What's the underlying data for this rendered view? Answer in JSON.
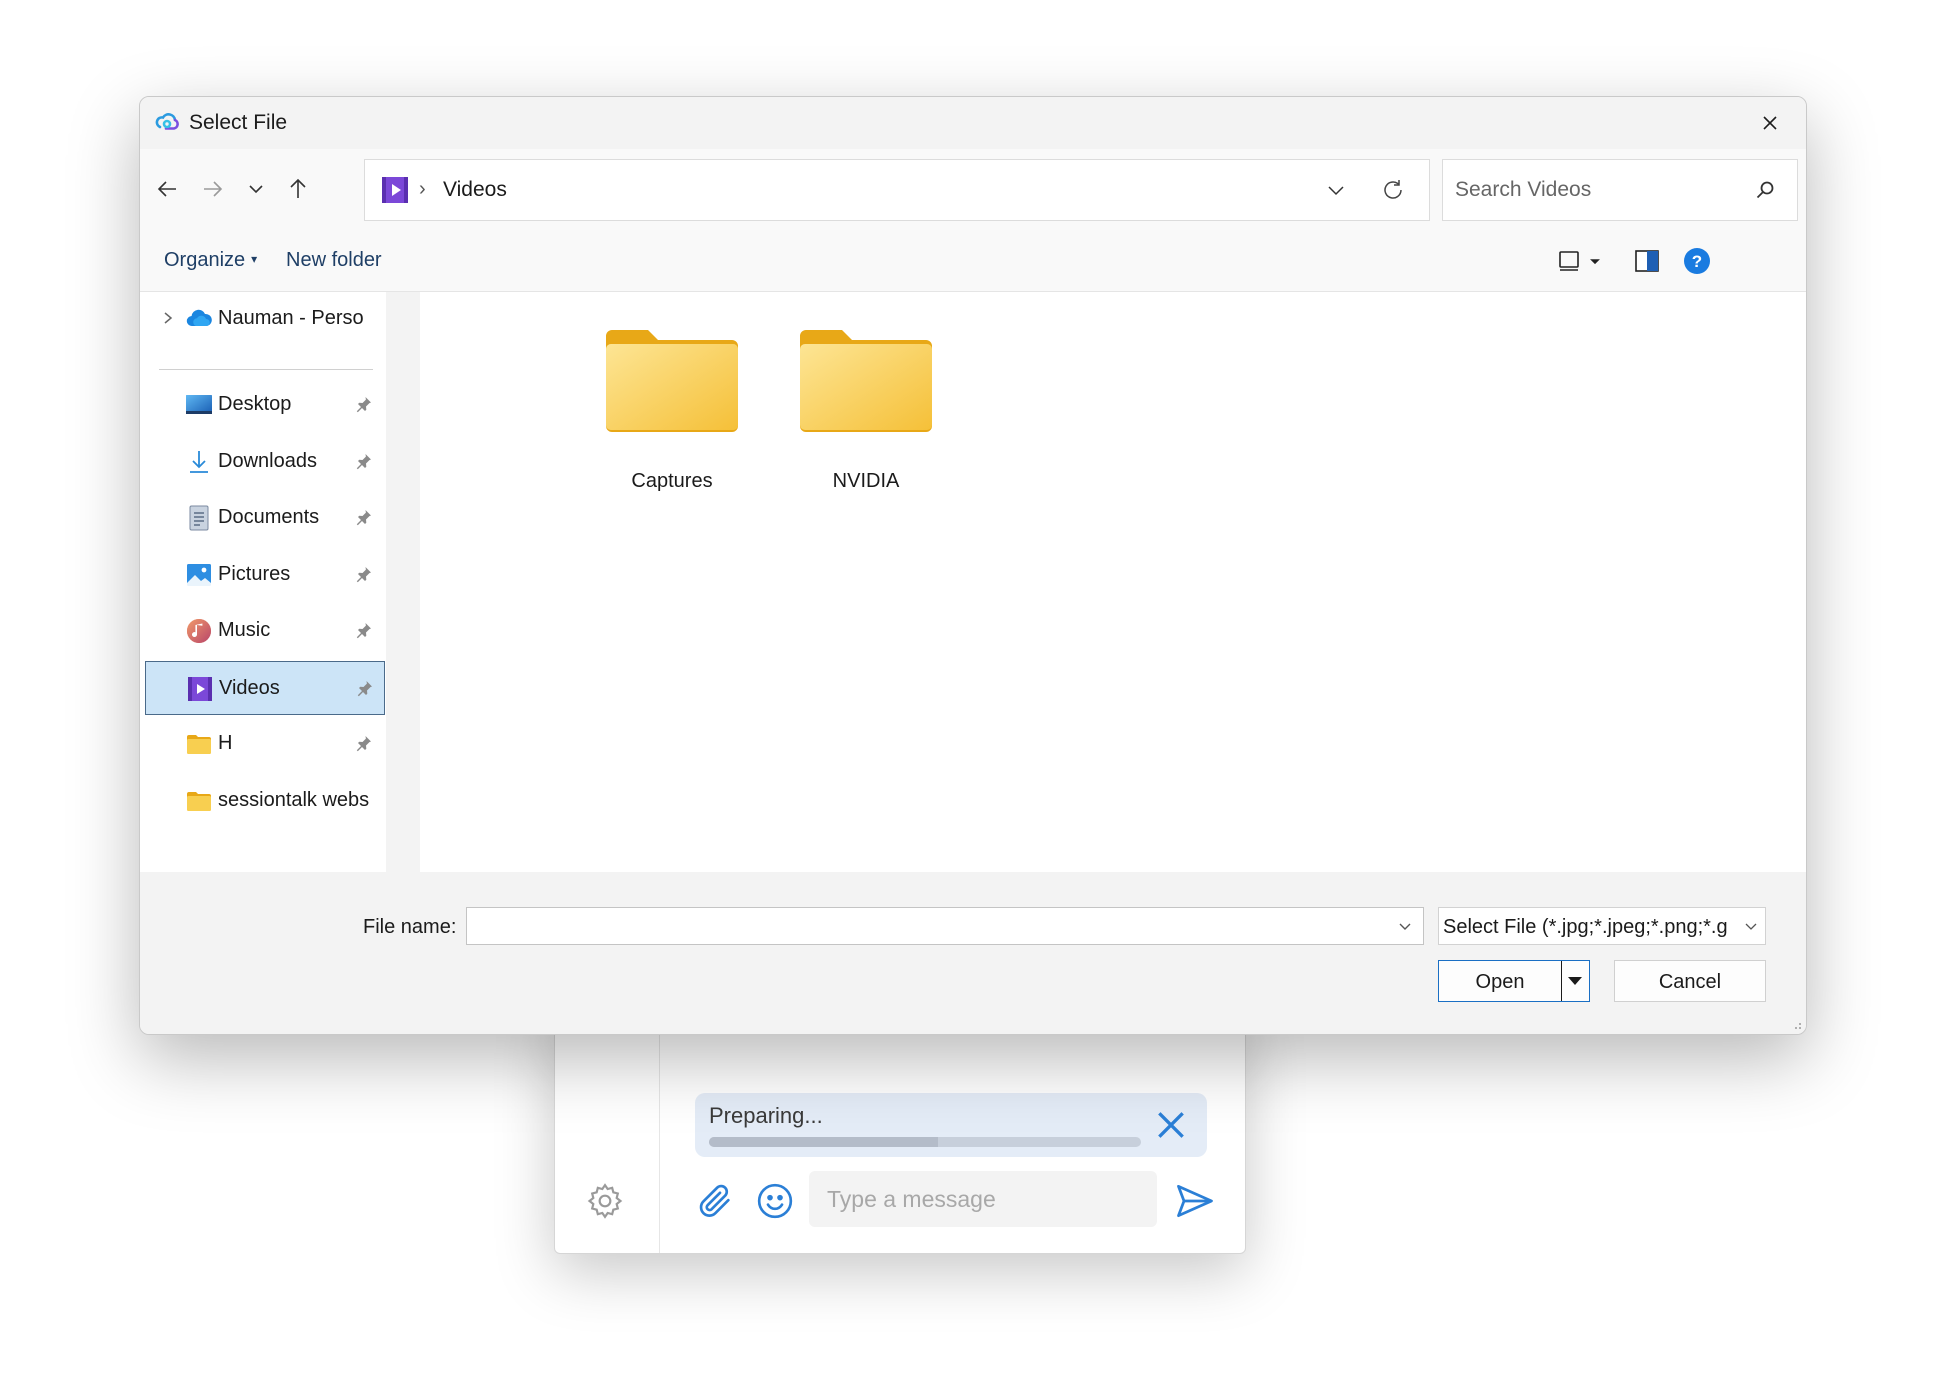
{
  "chat": {
    "upload_status": "Preparing...",
    "upload_progress": 0.53,
    "message_placeholder": "Type a message"
  },
  "dialog": {
    "title": "Select File",
    "address": {
      "current": "Videos"
    },
    "search_placeholder": "Search Videos",
    "commands": {
      "organize": "Organize",
      "new_folder": "New folder"
    },
    "nav": {
      "cloud": "Nauman - Perso",
      "items": [
        {
          "label": "Desktop",
          "icon": "desktop-icon",
          "pinned": true
        },
        {
          "label": "Downloads",
          "icon": "downloads-icon",
          "pinned": true
        },
        {
          "label": "Documents",
          "icon": "documents-icon",
          "pinned": true
        },
        {
          "label": "Pictures",
          "icon": "pictures-icon",
          "pinned": true
        },
        {
          "label": "Music",
          "icon": "music-icon",
          "pinned": true
        },
        {
          "label": "Videos",
          "icon": "videos-icon",
          "pinned": true,
          "selected": true
        },
        {
          "label": "H",
          "icon": "folder-icon",
          "pinned": true
        },
        {
          "label": "sessiontalk webs",
          "icon": "folder-icon",
          "pinned": false
        }
      ]
    },
    "folders": [
      {
        "name": "Captures"
      },
      {
        "name": "NVIDIA"
      }
    ],
    "file_name_label": "File name:",
    "file_name_value": "",
    "filter": "Select File (*.jpg;*.jpeg;*.png;*.g",
    "open_label": "Open",
    "cancel_label": "Cancel"
  },
  "colors": {
    "accent": "#1a6fc4",
    "selection": "#cce4f7",
    "folder": "#f5c038"
  }
}
